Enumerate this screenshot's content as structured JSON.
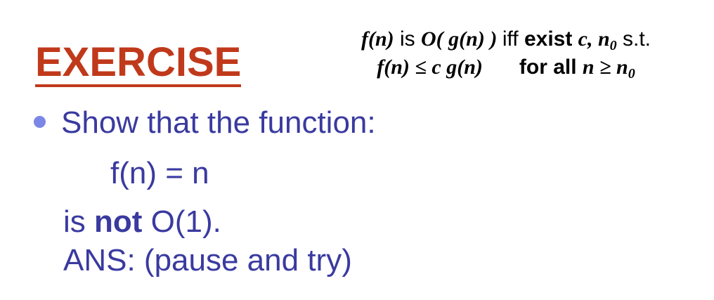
{
  "title": "EXERCISE",
  "definition": {
    "line1": {
      "fn": "f(n)",
      "is": " is ",
      "O_open": "O( ",
      "gn": "g(n)",
      "close": " ) ",
      "iff": "iff ",
      "exist": "exist ",
      "c": "c, n",
      "sub0": "0",
      "st": " s.t."
    },
    "line2": {
      "lhs": "f(n) ≤ c g(n)",
      "forall": "for all ",
      "cond": "n ≥ n",
      "sub0": "0"
    }
  },
  "bullet": "Show that the function:",
  "formula": "f(n) = n",
  "not_line": {
    "prefix": "is ",
    "bold": "not",
    "suffix": " O(1)."
  },
  "answer": "ANS: (pause and try)",
  "colors": {
    "title": "#c0391b",
    "body_text": "#3a3aa0",
    "bullet": "#7b86e6"
  }
}
